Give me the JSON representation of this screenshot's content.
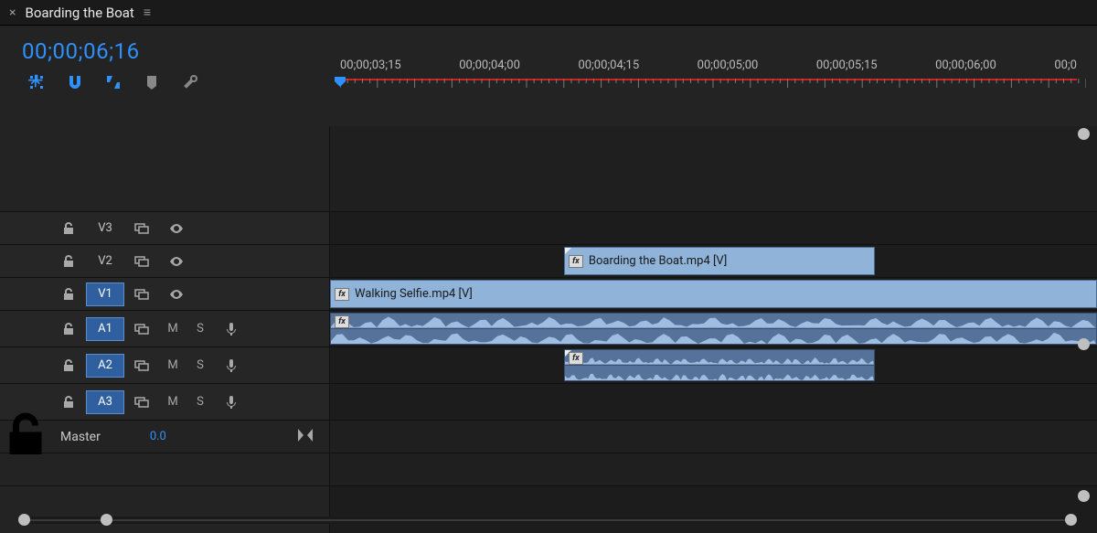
{
  "panel": {
    "title": "Boarding the Boat"
  },
  "timecode": "00;00;06;16",
  "ruler": {
    "labels": [
      "00;00;03;15",
      "00;00;04;00",
      "00;00;04;15",
      "00;00;05;00",
      "00;00;05;15",
      "00;00;06;00",
      "00;0"
    ]
  },
  "toolbar": {
    "insert_icon": "insert-timeline-icon",
    "snap_icon": "snap-magnet-icon",
    "linked_icon": "linked-selection-icon",
    "marker_icon": "marker-icon",
    "wrench_icon": "settings-wrench-icon"
  },
  "tracks": {
    "video": [
      {
        "name": "V3",
        "selected": false
      },
      {
        "name": "V2",
        "selected": false
      },
      {
        "name": "V1",
        "selected": true
      }
    ],
    "audio": [
      {
        "name": "A1",
        "selected": true
      },
      {
        "name": "A2",
        "selected": true
      },
      {
        "name": "A3",
        "selected": true
      }
    ],
    "mute_label": "M",
    "solo_label": "S"
  },
  "master": {
    "label": "Master",
    "value": "0.0"
  },
  "clips": {
    "v2": {
      "name": "Boarding the Boat.mp4 [V]",
      "left_pct": 30.5,
      "width_pct": 40.5
    },
    "v1": {
      "name": "Walking Selfie.mp4 [V]",
      "left_pct": 0,
      "width_pct": 100
    },
    "a1": {
      "left_pct": 0,
      "width_pct": 100
    },
    "a2": {
      "left_pct": 30.5,
      "width_pct": 40.5
    }
  }
}
